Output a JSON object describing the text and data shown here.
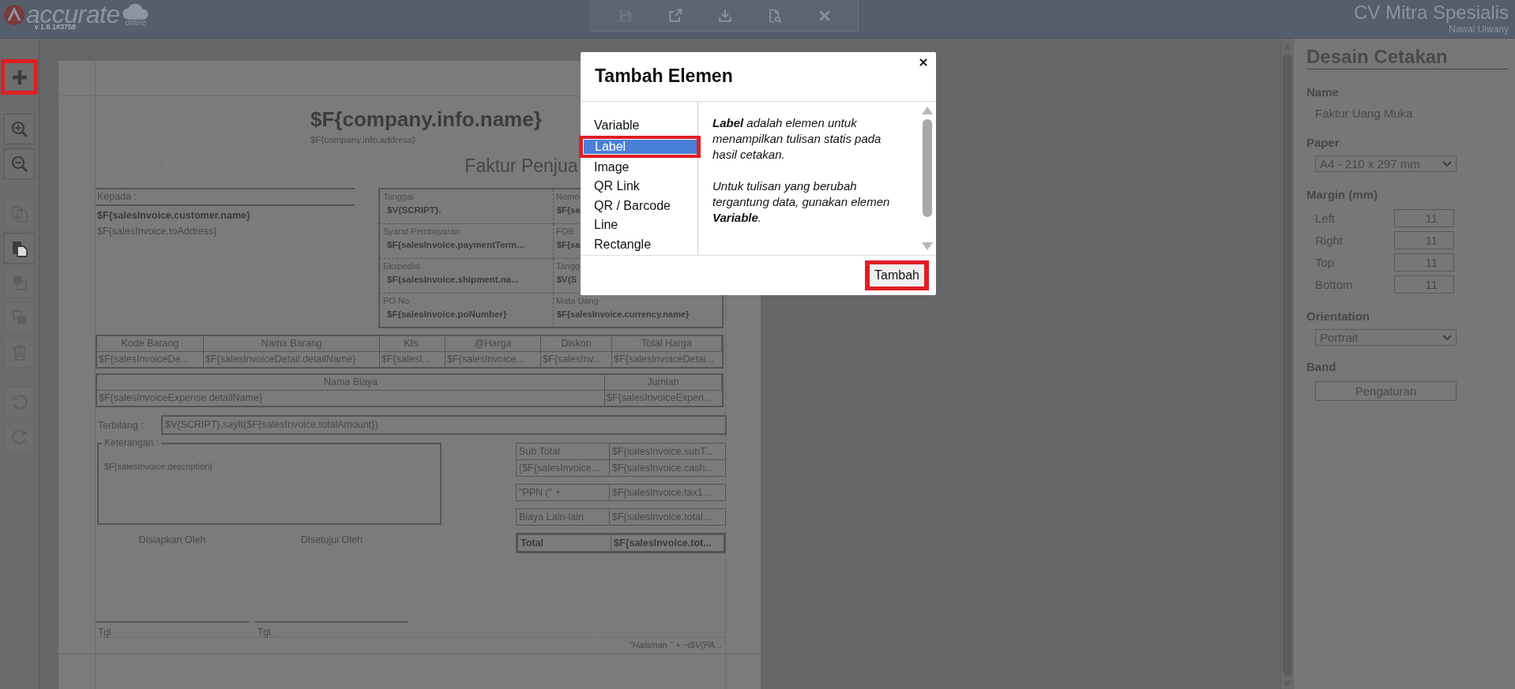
{
  "header": {
    "logo": {
      "name": "accurate",
      "tagline": "online",
      "version": "v 1.8.1#3758"
    },
    "toolbar": [
      {
        "kind": "save",
        "disabled": true
      },
      {
        "kind": "export",
        "disabled": false
      },
      {
        "kind": "import",
        "disabled": false
      },
      {
        "kind": "preview",
        "disabled": false
      },
      {
        "kind": "close",
        "disabled": false
      }
    ],
    "company": "CV Mitra Spesialis",
    "user": "Nawal Ulwany"
  },
  "left_toolbar": [
    [
      {
        "kind": "add",
        "disabled": false,
        "highlighted": true
      }
    ],
    [
      {
        "kind": "zoom_in",
        "disabled": false,
        "highlighted": false
      },
      {
        "kind": "zoom_out",
        "disabled": false,
        "highlighted": false
      }
    ],
    [
      {
        "kind": "copy",
        "disabled": true,
        "highlighted": false
      },
      {
        "kind": "paste",
        "disabled": false,
        "highlighted": false
      },
      {
        "kind": "front",
        "disabled": true,
        "highlighted": false
      },
      {
        "kind": "back",
        "disabled": true,
        "highlighted": false
      },
      {
        "kind": "delete",
        "disabled": true,
        "highlighted": false
      }
    ],
    [
      {
        "kind": "undo",
        "disabled": true,
        "highlighted": false
      },
      {
        "kind": "redo",
        "disabled": true,
        "highlighted": false
      }
    ]
  ],
  "document": {
    "company_name": "$F{company.info.name}",
    "company_address": "$F{company.info.address}",
    "colon": ":",
    "title": "Faktur Penjua",
    "recipient": {
      "label": "Kepada :",
      "name": "$F{salesInvoice.customer.name}",
      "address": "$F{salesInvoice.toAddress}"
    },
    "info_fields": [
      {
        "label": "Tanggal",
        "value": "$V{SCRIPT}."
      },
      {
        "label": "Nomo",
        "value": "$F{sa"
      },
      {
        "label": "Syarat Pembayaran",
        "value": "$F{salesInvoice.paymentTerm..."
      },
      {
        "label": "FOB",
        "value": "$F{sa"
      },
      {
        "label": "Ekspedisi",
        "value": "$F{salesInvoice.shipment.na..."
      },
      {
        "label": "Tangg",
        "value": "$V{S"
      },
      {
        "label": "PO No",
        "value": "$F{salesInvoice.poNumber}"
      },
      {
        "label": "Mata Uang",
        "value": "$F{salesInvoice.currency.name}"
      }
    ],
    "items_table": {
      "columns": [
        "Kode Barang",
        "Nama Barang",
        "Kts.",
        "@Harga",
        "Diskon",
        "Total Harga"
      ],
      "rows": [
        [
          "$F{salesInvoiceDe...",
          "$F{salesInvoiceDetail.detailName}",
          "$F{salesI...",
          "$F{salesInvoice...",
          "$F{salesInv...",
          "$F{salesInvoiceDetai..."
        ]
      ]
    },
    "expense_table": {
      "columns": [
        "Nama Biaya",
        "Jumlah"
      ],
      "rows": [
        [
          "$F{salesInvoiceExpense.detailName}",
          "$F{salesInvoiceExpen..."
        ]
      ]
    },
    "amount_in_words": {
      "label": "Terbilang :",
      "value": "$V{SCRIPT}.sayIt($F{salesInvoice.totalAmount})"
    },
    "notes": {
      "legend": "Keterangan :",
      "value": "$F{salesInvoice.description}"
    },
    "totals": [
      [
        {
          "label": "Sub Total",
          "value": "$F{salesInvoice.subT...",
          "kind": "normal"
        },
        {
          "label": "($F{salesInvoice...",
          "value": "$F{salesInvoice.cash...",
          "kind": "normal"
        }
      ],
      [
        {
          "label": "\"PPN (\" +",
          "value": "$F{salesInvoice.tax1...",
          "kind": "normal"
        }
      ],
      [
        {
          "label": "Biaya Lain-lain",
          "value": "$F{salesInvoice.total...",
          "kind": "normal"
        }
      ],
      [
        {
          "label": "Total",
          "value": "$F{salesInvoice.tot...",
          "kind": "total"
        }
      ]
    ],
    "signatures": [
      {
        "title": "Disiapkan Oleh",
        "date_label": "Tgl"
      },
      {
        "title": "Disetujui Oleh",
        "date_label": "Tgl."
      }
    ],
    "footer": "\"Halaman \" +  ~t$V{PA..."
  },
  "dialog": {
    "title": "Tambah Elemen",
    "items": [
      {
        "label": "Variable",
        "selected": false,
        "highlighted": false
      },
      {
        "label": "Label",
        "selected": true,
        "highlighted": true
      },
      {
        "label": "Image",
        "selected": false,
        "highlighted": false
      },
      {
        "label": "QR Link",
        "selected": false,
        "highlighted": false
      },
      {
        "label": "QR / Barcode",
        "selected": false,
        "highlighted": false
      },
      {
        "label": "Line",
        "selected": false,
        "highlighted": false
      },
      {
        "label": "Rectangle",
        "selected": false,
        "highlighted": false
      }
    ],
    "description": [
      "**Label** adalah elemen untuk menampilkan tulisan statis pada hasil cetakan.",
      "Untuk tulisan yang berubah tergantung data, gunakan elemen **Variable**."
    ],
    "button": {
      "label": "Tambah",
      "highlighted": true
    }
  },
  "properties": {
    "title": "Desain Cetakan",
    "name_label": "Name",
    "name_value": "Faktur Uang Muka",
    "paper_label": "Paper",
    "paper_value": "A4 - 210 x 297 mm",
    "margin_label": "Margin (mm)",
    "margins": [
      {
        "label": "Left",
        "value": "11"
      },
      {
        "label": "Right",
        "value": "11"
      },
      {
        "label": "Top",
        "value": "11"
      },
      {
        "label": "Bottom",
        "value": "11"
      }
    ],
    "orientation_label": "Orientation",
    "orientation_value": "Portrait",
    "band_label": "Band",
    "band_button": "Pengaturan"
  }
}
